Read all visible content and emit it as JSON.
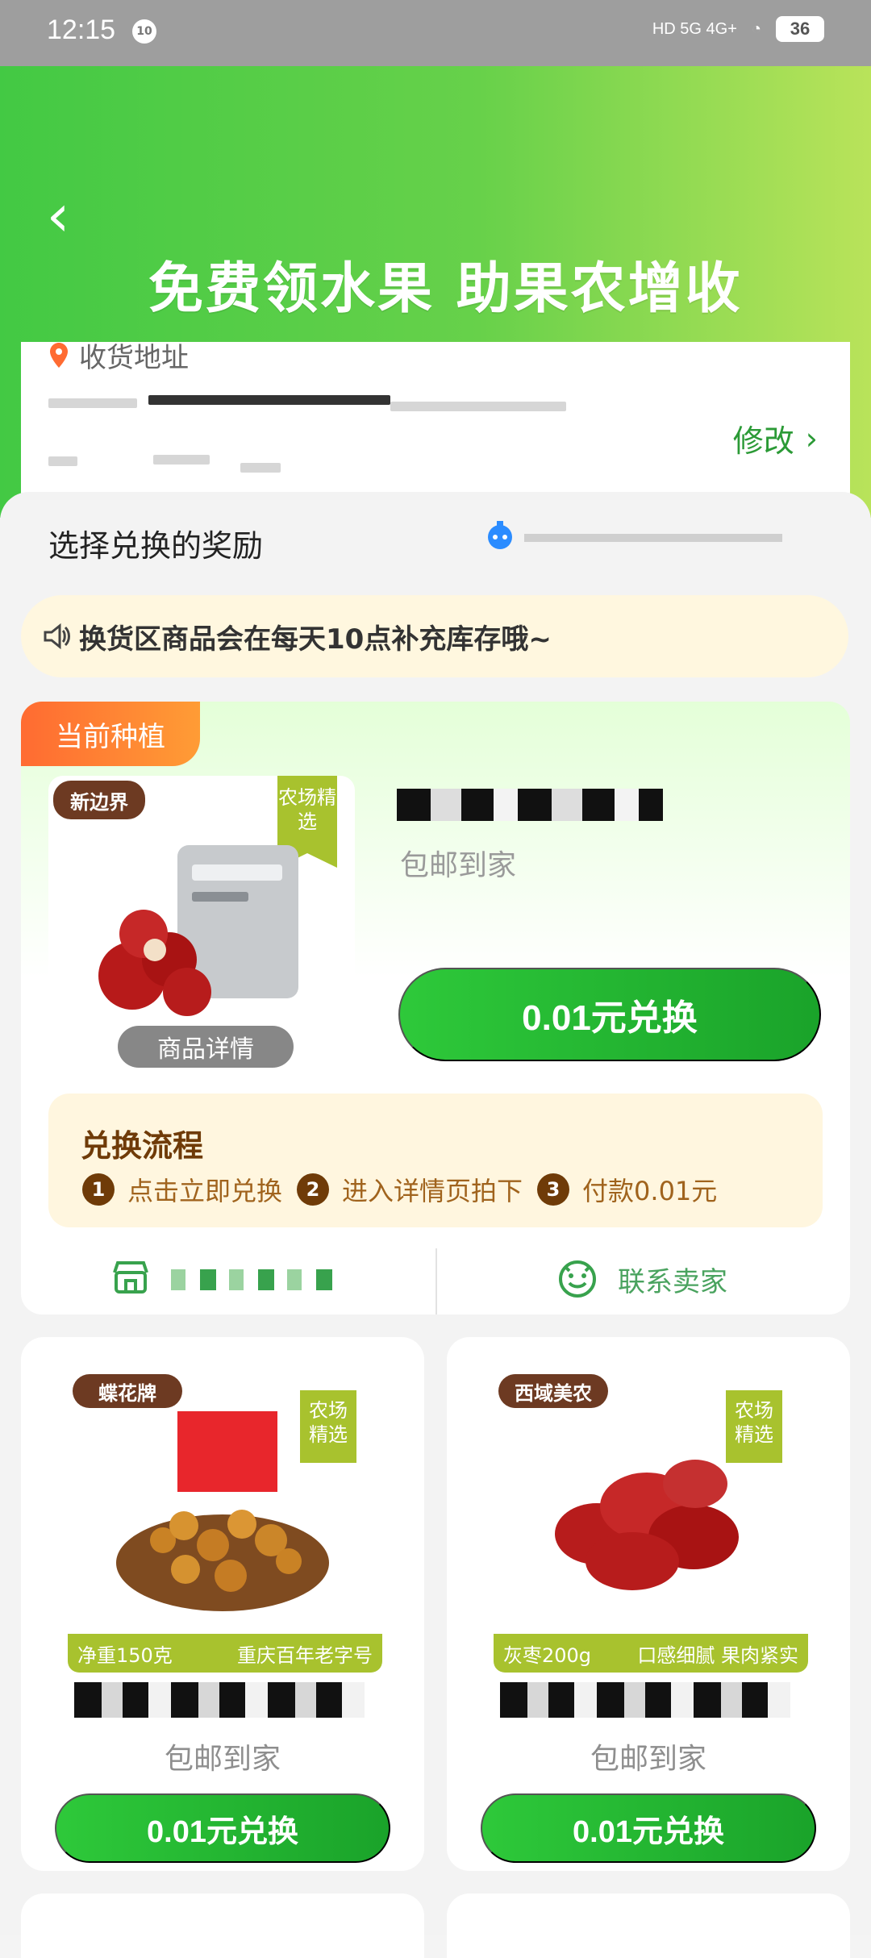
{
  "status_bar": {
    "time": "12:15",
    "notification_badge": "10",
    "signal": "HD 5G 4G+",
    "battery": "36"
  },
  "header": {
    "title": "免费领水果 助果农增收"
  },
  "address": {
    "label": "收货地址",
    "modify_label": "修改"
  },
  "rewards": {
    "section_title": "选择兑换的奖励",
    "notice": "换货区商品会在每天10点补充库存哦~",
    "current": {
      "tag": "当前种植",
      "brand": "新边界",
      "farm_badge": "农场精选",
      "overlay": "商品详情",
      "shipping": "包邮到家",
      "button": "0.01元兑换",
      "flow_title": "兑换流程",
      "steps": [
        {
          "num": "1",
          "text": "点击立即兑换"
        },
        {
          "num": "2",
          "text": "进入详情页拍下"
        },
        {
          "num": "3",
          "text": "付款0.01元"
        }
      ],
      "contact_seller": "联系卖家"
    },
    "grid": [
      {
        "brand": "蝶花牌",
        "farm_badge": "农场精选",
        "bottom_left": "净重150克",
        "bottom_right": "重庆百年老字号",
        "shipping": "包邮到家",
        "button": "0.01元兑换"
      },
      {
        "brand": "西域美农",
        "farm_badge": "农场精选",
        "bottom_left": "灰枣200g",
        "bottom_right": "口感细腻 果肉紧实",
        "shipping": "包邮到家",
        "button": "0.01元兑换"
      }
    ]
  },
  "colors": {
    "hero_green": "#43c944",
    "accent_green": "#1aa32a",
    "orange_tag": "#ff6b32",
    "flow_bg": "#fff6df"
  }
}
